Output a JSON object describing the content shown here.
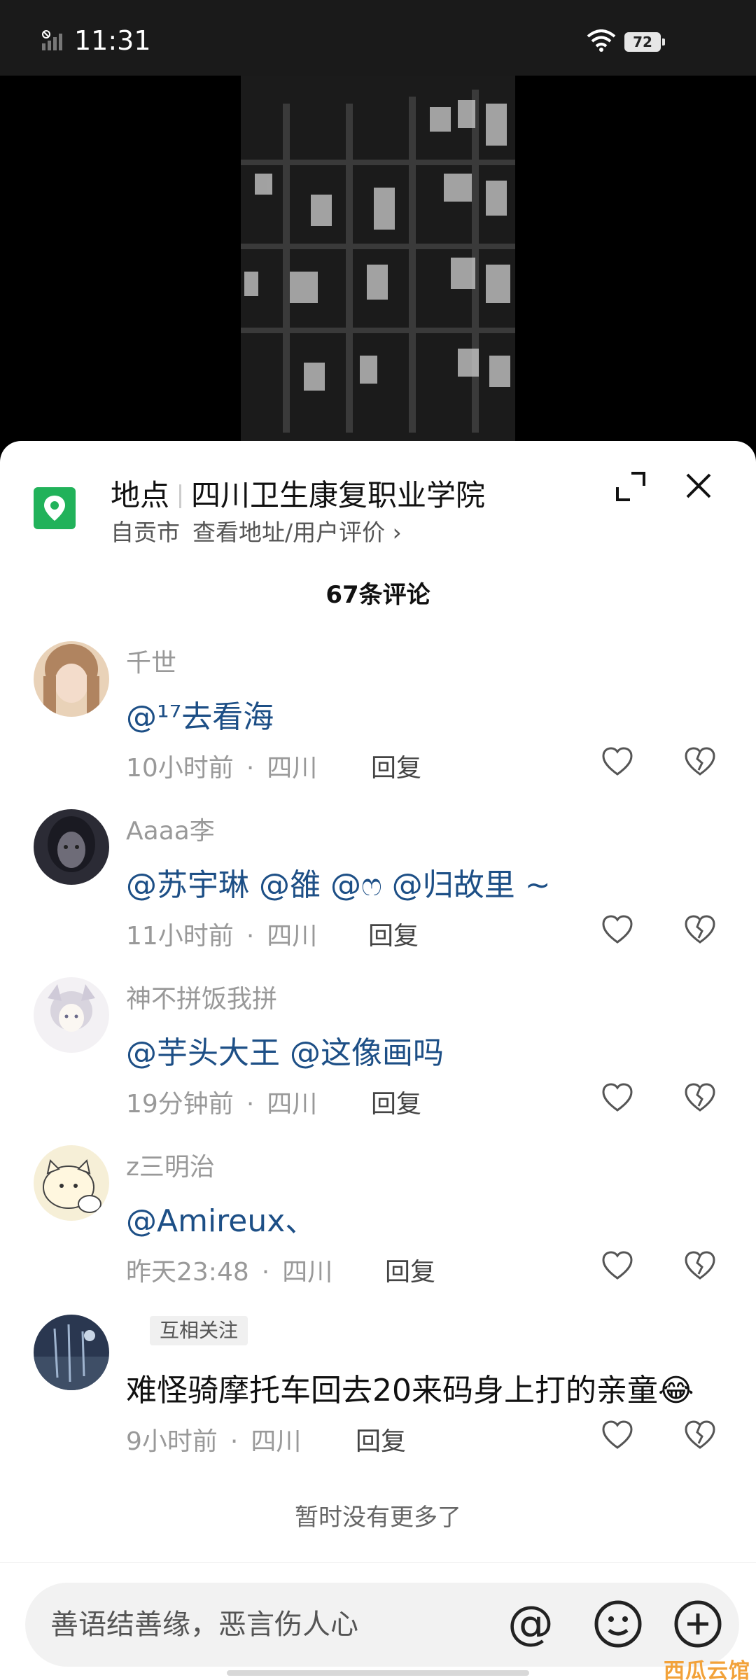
{
  "status_bar": {
    "time": "11:31",
    "battery": "72"
  },
  "location": {
    "label": "地点",
    "name": "四川卫生康复职业学院",
    "city": "自贡市",
    "link": "查看地址/用户评价 ›"
  },
  "comments_header": {
    "count_text": "67条评论"
  },
  "comments": [
    {
      "user": "千世",
      "badge": "",
      "mentions": [
        "@¹⁷去看海"
      ],
      "text": "",
      "time": "10小时前",
      "region": "四川",
      "reply": "回复"
    },
    {
      "user": "Aaaa李",
      "badge": "",
      "mentions": [
        "@苏宇琳",
        "@雒",
        "@ෆ",
        "@归故里 ~"
      ],
      "text": "",
      "time": "11小时前",
      "region": "四川",
      "reply": "回复"
    },
    {
      "user": "神不拼饭我拼",
      "badge": "",
      "mentions": [
        "@芋头大王",
        "@这像画吗"
      ],
      "text": "",
      "time": "19分钟前",
      "region": "四川",
      "reply": "回复"
    },
    {
      "user": "z三明治",
      "badge": "",
      "mentions": [
        "@Amireux、"
      ],
      "text": "",
      "time": "昨天23:48",
      "region": "四川",
      "reply": "回复"
    },
    {
      "user": "",
      "badge": "互相关注",
      "mentions": [],
      "text": "难怪骑摩托车回去20来码身上打的亲童😂",
      "time": "9小时前",
      "region": "四川",
      "reply": "回复"
    }
  ],
  "footer": {
    "no_more": "暂时没有更多了"
  },
  "input": {
    "placeholder": "善语结善缘，恶言伤人心",
    "at_symbol": "@"
  },
  "watermark": "西瓜云馆",
  "colors": {
    "mention": "#1d4f86",
    "pin": "#21b25a",
    "sheet": "#ffffff"
  }
}
